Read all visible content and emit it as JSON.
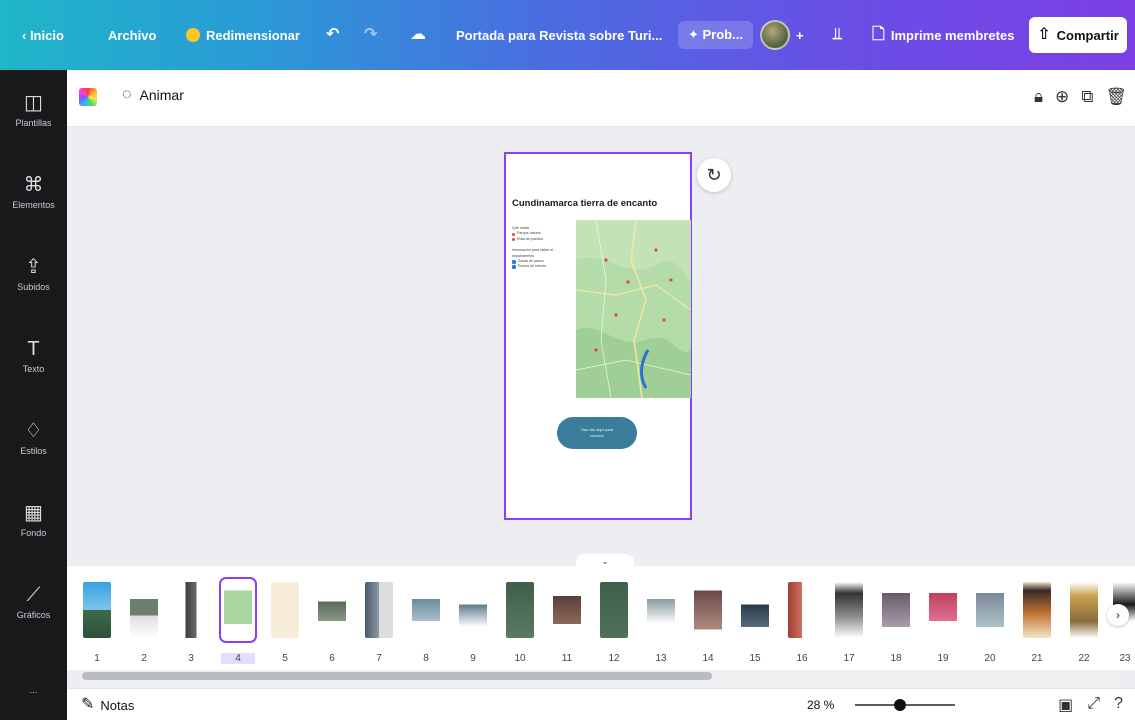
{
  "topbar": {
    "back_label": "‹ Inicio",
    "file_label": "Archivo",
    "resize_label": "Redimensionar",
    "undo_icon": "undo-icon",
    "redo_icon": "redo-icon",
    "cloud_icon": "cloud-save-icon",
    "title": "Portada para Revista sobre Turi...",
    "pro_label": "Prob...",
    "add_label": "+",
    "chart_icon": "bar-chart-icon",
    "print_label": "Imprime membretes",
    "share_label": "Compartir"
  },
  "sidebar": {
    "items": [
      {
        "label": "Plantillas",
        "icon": "layout-icon"
      },
      {
        "label": "Elementos",
        "icon": "shapes-icon"
      },
      {
        "label": "Subidos",
        "icon": "upload-icon"
      },
      {
        "label": "Texto",
        "icon": "text-icon"
      },
      {
        "label": "Estilos",
        "icon": "palette-icon"
      },
      {
        "label": "Fondo",
        "icon": "background-icon"
      },
      {
        "label": "Gráficos",
        "icon": "chart-icon"
      },
      {
        "label": "...",
        "icon": "more-icon"
      }
    ]
  },
  "subbar": {
    "animate_label": "Animar"
  },
  "page": {
    "title": "Cundinamarca tierra de encanto",
    "legend_header_1": "Qué visitar",
    "legend_items_1": [
      "Parque natural",
      "Ruta de pueblos"
    ],
    "legend_header_2": "Información para visitar el departamento",
    "legend_items_2": [
      "Zonas de paseo",
      "Puntos de interés"
    ],
    "cta": "Haz clic aquí para conocer"
  },
  "filmstrip": {
    "pages": [
      "1",
      "2",
      "3",
      "4",
      "5",
      "6",
      "7",
      "8",
      "9",
      "10",
      "11",
      "12",
      "13",
      "14",
      "15",
      "16",
      "17",
      "18",
      "19",
      "20",
      "21",
      "22",
      "23"
    ],
    "selected_index": 3
  },
  "bottombar": {
    "notes_label": "Notas",
    "zoom_label": "28 %",
    "zoom_level": 0.28
  },
  "colors": {
    "accent": "#8b3dff",
    "sidebar_bg": "#18191b",
    "gradient_start": "#1fb6c8",
    "gradient_end": "#7b3fe4",
    "cta": "#3a7d9a",
    "map_green": "#a9d6a0"
  }
}
